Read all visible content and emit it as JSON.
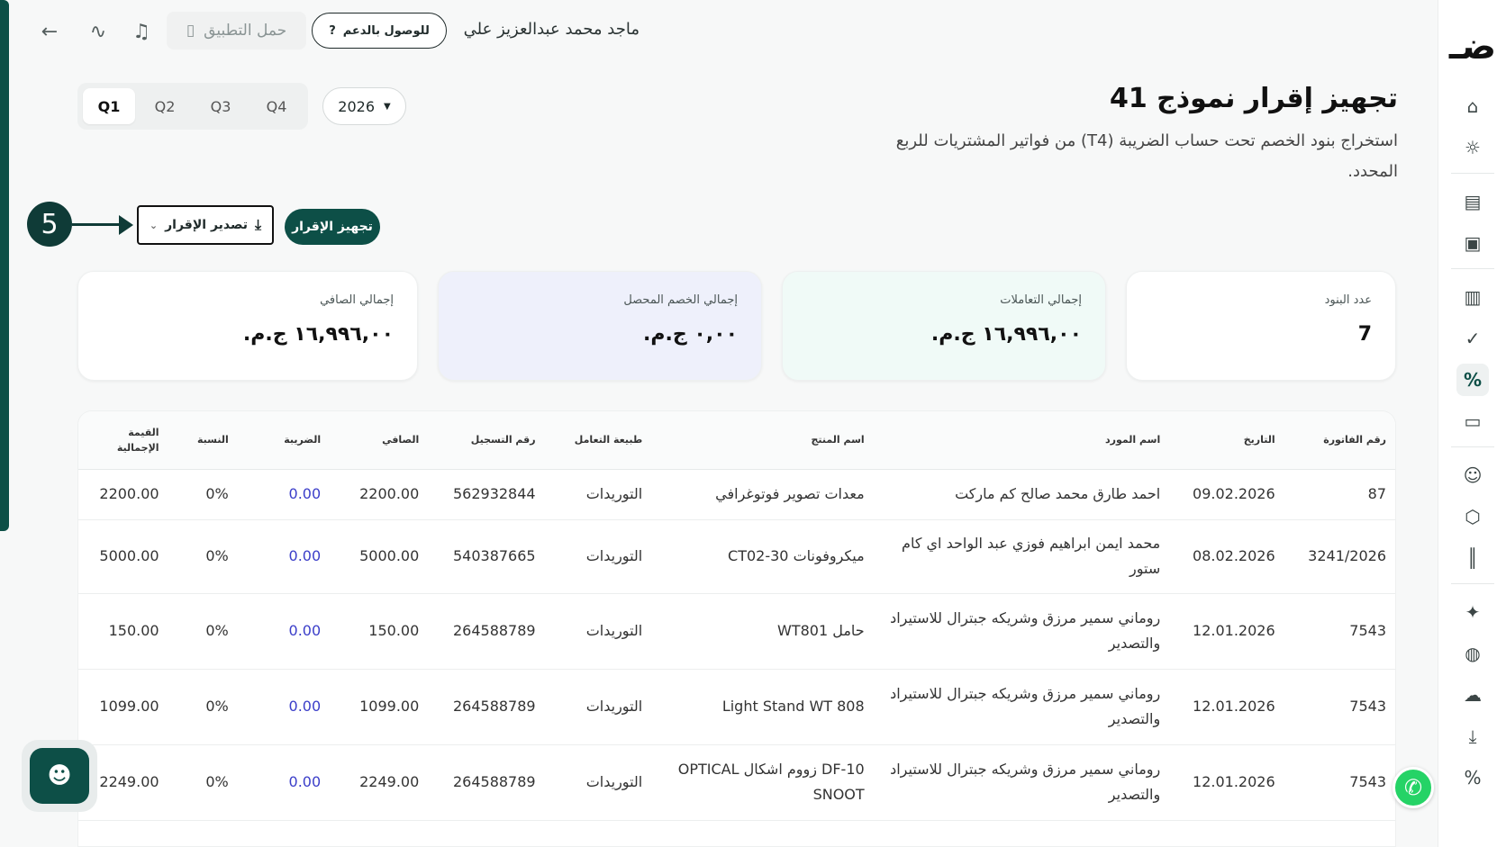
{
  "topbar": {
    "user_name": "ماجد محمد عبدالعزيز علي",
    "support_label": "للوصول بالدعم",
    "app_label": "حمل التطبيق"
  },
  "header": {
    "title": "تجهيز إقرار نموذج 41",
    "subtitle": "استخراج بنود الخصم تحت حساب الضريبة (T4) من فواتير المشتريات للربع المحدد."
  },
  "filters": {
    "quarters": [
      "Q1",
      "Q2",
      "Q3",
      "Q4"
    ],
    "selected_quarter": "Q1",
    "year": "2026"
  },
  "actions": {
    "prepare_label": "تجهيز الإقرار",
    "export_label": "تصدير الإقرار",
    "step_number": "5"
  },
  "cards": [
    {
      "label": "عدد البنود",
      "value": "7"
    },
    {
      "label": "إجمالي التعاملات",
      "value": "١٦,٩٩٦,٠٠ ج.م."
    },
    {
      "label": "إجمالي الخصم المحصل",
      "value": "٠,٠٠ ج.م."
    },
    {
      "label": "إجمالي الصافي",
      "value": "١٦,٩٩٦,٠٠ ج.م."
    }
  ],
  "table": {
    "headers": [
      "رقم الفاتورة",
      "التاريخ",
      "اسم المورد",
      "اسم المنتج",
      "طبيعة التعامل",
      "رقم التسجيل",
      "الصافي",
      "الضريبة",
      "النسبة",
      "القيمة الإجمالية"
    ],
    "rows": [
      {
        "invoice": "87",
        "date": "09.02.2026",
        "supplier": "احمد طارق محمد صالح كم ماركت",
        "product": "معدات تصوير فوتوغرافي",
        "type": "التوريدات",
        "reg": "562932844",
        "net": "2200.00",
        "tax": "0.00",
        "rate": "0%",
        "total": "2200.00"
      },
      {
        "invoice": "3241/2026",
        "date": "08.02.2026",
        "supplier": "محمد ايمن ابراهيم فوزي عبد الواحد اي كام ستور",
        "product": "ميكروفونات CT02-30",
        "type": "التوريدات",
        "reg": "540387665",
        "net": "5000.00",
        "tax": "0.00",
        "rate": "0%",
        "total": "5000.00"
      },
      {
        "invoice": "7543",
        "date": "12.01.2026",
        "supplier": "روماني سمير مرزق وشريكه جبترال للاستيراد والتصدير",
        "product": "حامل WT801",
        "type": "التوريدات",
        "reg": "264588789",
        "net": "150.00",
        "tax": "0.00",
        "rate": "0%",
        "total": "150.00"
      },
      {
        "invoice": "7543",
        "date": "12.01.2026",
        "supplier": "روماني سمير مرزق وشريكه جبترال للاستيراد والتصدير",
        "product": "Light Stand WT 808",
        "type": "التوريدات",
        "reg": "264588789",
        "net": "1099.00",
        "tax": "0.00",
        "rate": "0%",
        "total": "1099.00"
      },
      {
        "invoice": "7543",
        "date": "12.01.2026",
        "supplier": "روماني سمير مرزق وشريكه جبترال للاستيراد والتصدير",
        "product": "DF-10 زووم اشكال OPTICAL SNOOT",
        "type": "التوريدات",
        "reg": "264588789",
        "net": "2249.00",
        "tax": "0.00",
        "rate": "0%",
        "total": "2249.00"
      }
    ]
  },
  "colors": {
    "brand": "#0d4f47",
    "tax_value": "#3b3ec9"
  }
}
